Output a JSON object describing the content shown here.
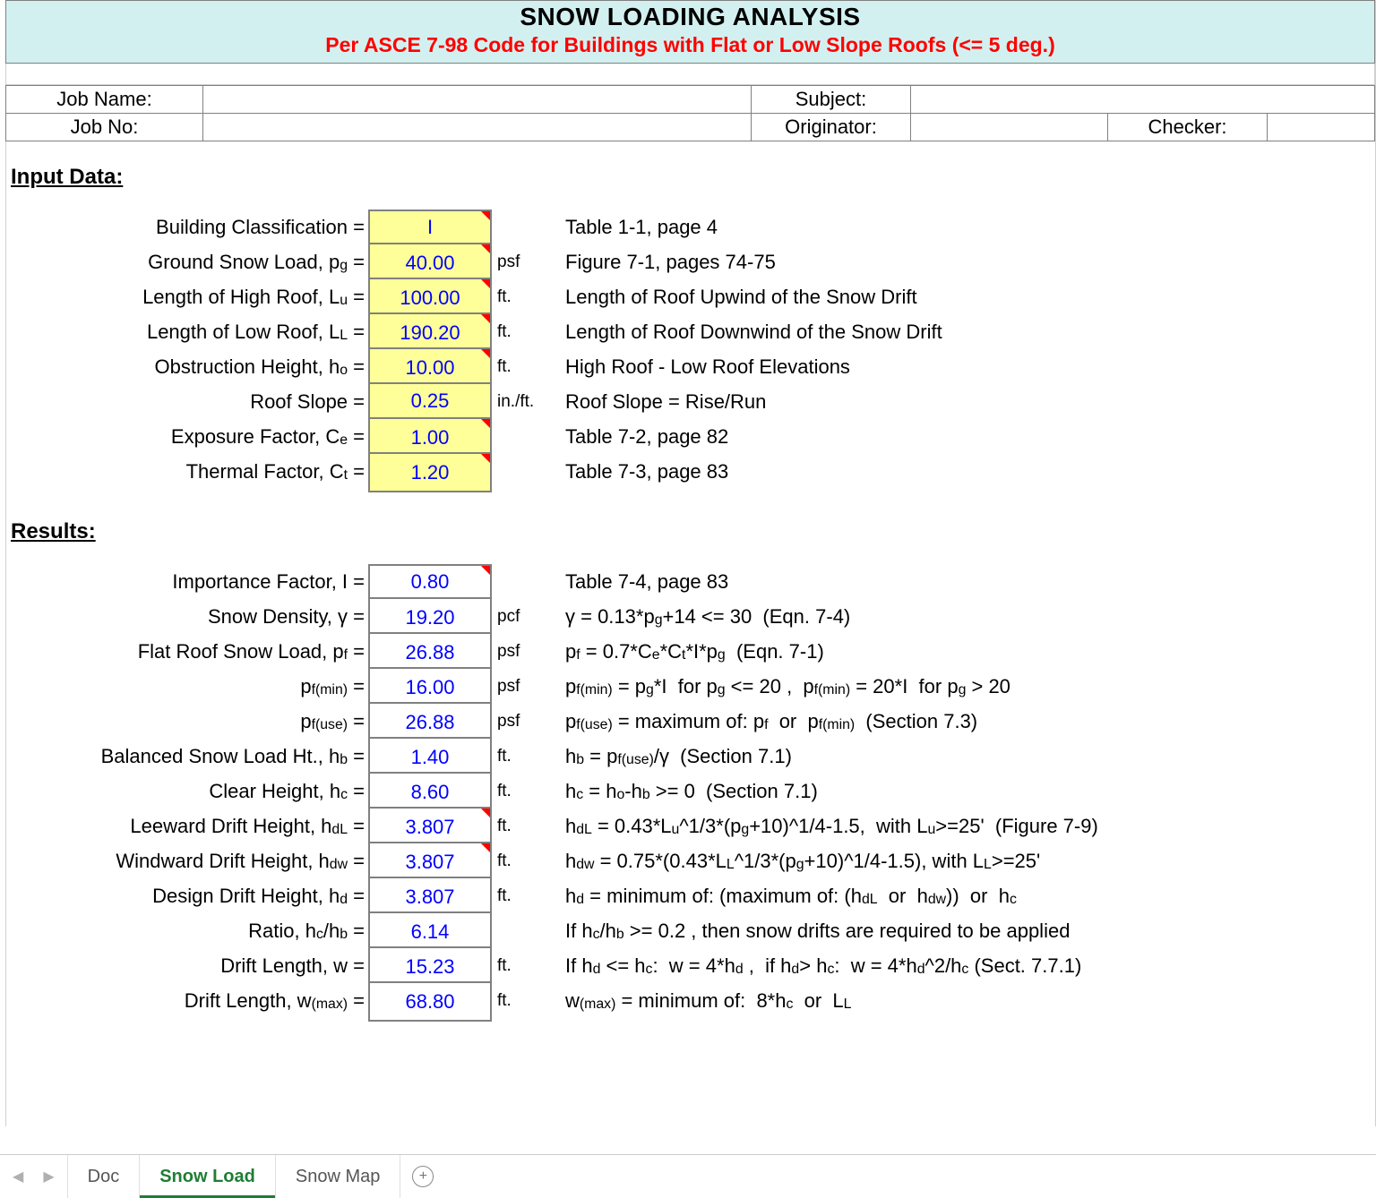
{
  "banner": {
    "title": "SNOW LOADING ANALYSIS",
    "subtitle": "Per ASCE 7-98 Code for Buildings with Flat or Low Slope Roofs (<= 5 deg.)"
  },
  "job": {
    "name_label": "Job Name:",
    "name_value": "",
    "no_label": "Job No:",
    "no_value": "",
    "subject_label": "Subject:",
    "subject_value": "",
    "originator_label": "Originator:",
    "originator_value": "",
    "checker_label": "Checker:",
    "checker_value": ""
  },
  "sections": {
    "input_heading": "Input Data:",
    "results_heading": "Results:"
  },
  "inputs": [
    {
      "label_html": "Building Classification =",
      "value": "I",
      "unit": "",
      "note_html": "Table 1-1, page 4",
      "hint": true
    },
    {
      "label_html": "Ground Snow Load, p<span class='sub'>g</span> =",
      "value": "40.00",
      "unit": "psf",
      "note_html": "Figure 7-1, pages 74-75",
      "hint": true
    },
    {
      "label_html": "Length of High Roof, L<span class='sub'>u</span> =",
      "value": "100.00",
      "unit": "ft.",
      "note_html": "Length of Roof Upwind of the Snow Drift",
      "hint": true
    },
    {
      "label_html": "Length of Low Roof, L<span class='sub'>L</span> =",
      "value": "190.20",
      "unit": "ft.",
      "note_html": "Length of Roof Downwind of the Snow Drift",
      "hint": true
    },
    {
      "label_html": "Obstruction Height, h<span class='sub'>o</span> =",
      "value": "10.00",
      "unit": "ft.",
      "note_html": "High Roof - Low Roof Elevations",
      "hint": true
    },
    {
      "label_html": "Roof Slope =",
      "value": "0.25",
      "unit": "in./ft.",
      "note_html": "Roof Slope = Rise/Run",
      "hint": false
    },
    {
      "label_html": "Exposure Factor, C<span class='sub'>e</span> =",
      "value": "1.00",
      "unit": "",
      "note_html": "Table 7-2, page 82",
      "hint": true
    },
    {
      "label_html": "Thermal Factor, C<span class='sub'>t</span> =",
      "value": "1.20",
      "unit": "",
      "note_html": "Table 7-3, page 83",
      "hint": true
    }
  ],
  "results": [
    {
      "label_html": "Importance Factor, I =",
      "value": "0.80",
      "unit": "",
      "note_html": "Table 7-4, page 83",
      "hint": true
    },
    {
      "label_html": "Snow Density, &#947; =",
      "value": "19.20",
      "unit": "pcf",
      "note_html": "&#947; = 0.13*p<span class='sub'>g</span>+14 &lt;= 30&nbsp;&nbsp;(Eqn. 7-4)",
      "hint": false
    },
    {
      "label_html": "Flat Roof Snow Load, p<span class='sub'>f</span> =",
      "value": "26.88",
      "unit": "psf",
      "note_html": "p<span class='sub'>f</span> = 0.7*C<span class='sub'>e</span>*C<span class='sub'>t</span>*I*p<span class='sub'>g</span>&nbsp;&nbsp;(Eqn. 7-1)",
      "hint": false
    },
    {
      "label_html": "p<span class='sub'>f(min)</span> =",
      "value": "16.00",
      "unit": "psf",
      "note_html": "p<span class='sub'>f(min)</span> = p<span class='sub'>g</span>*I&nbsp; for p<span class='sub'>g</span> &lt;= 20 ,&nbsp;&nbsp;p<span class='sub'>f(min)</span> = 20*I&nbsp; for p<span class='sub'>g</span> &gt; 20",
      "hint": false
    },
    {
      "label_html": "p<span class='sub'>f(use)</span> =",
      "value": "26.88",
      "unit": "psf",
      "note_html": "p<span class='sub'>f(use)</span> = maximum of: p<span class='sub'>f</span>&nbsp; or&nbsp; p<span class='sub'>f(min)</span>&nbsp;&nbsp;(Section 7.3)",
      "hint": false
    },
    {
      "label_html": "Balanced Snow Load Ht., h<span class='sub'>b</span> =",
      "value": "1.40",
      "unit": "ft.",
      "note_html": "h<span class='sub'>b</span> = p<span class='sub'>f(use)</span>/&#947;&nbsp;&nbsp;(Section 7.1)",
      "hint": false
    },
    {
      "label_html": "Clear Height, h<span class='sub'>c</span> =",
      "value": "8.60",
      "unit": "ft.",
      "note_html": "h<span class='sub'>c</span> = h<span class='sub'>o</span>-h<span class='sub'>b</span> &gt;= 0&nbsp;&nbsp;(Section 7.1)",
      "hint": false
    },
    {
      "label_html": "Leeward Drift Height, h<span class='sub'>dL</span> =",
      "value": "3.807",
      "unit": "ft.",
      "note_html": "h<span class='sub'>dL</span> = 0.43*L<span class='sub'>u</span>^1/3*(p<span class='sub'>g</span>+10)^1/4-1.5,&nbsp; with L<span class='sub'>u</span>&gt;=25'&nbsp;&nbsp;(Figure 7-9)",
      "hint": true
    },
    {
      "label_html": "Windward Drift Height, h<span class='sub'>dw</span> =",
      "value": "3.807",
      "unit": "ft.",
      "note_html": "h<span class='sub'>dw</span> = 0.75*(0.43*L<span class='sub'>L</span>^1/3*(p<span class='sub'>g</span>+10)^1/4-1.5), with L<span class='sub'>L</span>&gt;=25'",
      "hint": true
    },
    {
      "label_html": "Design Drift Height, h<span class='sub'>d</span> =",
      "value": "3.807",
      "unit": "ft.",
      "note_html": "h<span class='sub'>d</span> = minimum of: (maximum of: (h<span class='sub'>dL</span>&nbsp; or&nbsp; h<span class='sub'>dw</span>))&nbsp; or&nbsp; h<span class='sub'>c</span>",
      "hint": false
    },
    {
      "label_html": "Ratio, h<span class='sub'>c</span>/h<span class='sub'>b</span> =",
      "value": "6.14",
      "unit": "",
      "note_html": "If h<span class='sub'>c</span>/h<span class='sub'>b</span> &gt;= 0.2 , then snow drifts are required to be applied",
      "hint": false
    },
    {
      "label_html": "Drift Length, w =",
      "value": "15.23",
      "unit": "ft.",
      "note_html": "If h<span class='sub'>d</span> &lt;= h<span class='sub'>c</span>:&nbsp; w = 4*h<span class='sub'>d</span> ,&nbsp; if h<span class='sub'>d</span>&gt; h<span class='sub'>c</span>:&nbsp; w = 4*h<span class='sub'>d</span>^2/h<span class='sub'>c</span>&nbsp;(Sect. 7.7.1)",
      "hint": false
    },
    {
      "label_html": "Drift Length, w<span class='sub'>(max)</span> =",
      "value": "68.80",
      "unit": "ft.",
      "note_html": "w<span class='sub'>(max)</span> = minimum of:&nbsp; 8*h<span class='sub'>c</span>&nbsp; or&nbsp; L<span class='sub'>L</span>",
      "hint": false
    }
  ],
  "tabs": {
    "items": [
      "Doc",
      "Snow Load",
      "Snow Map"
    ],
    "active_index": 1
  }
}
